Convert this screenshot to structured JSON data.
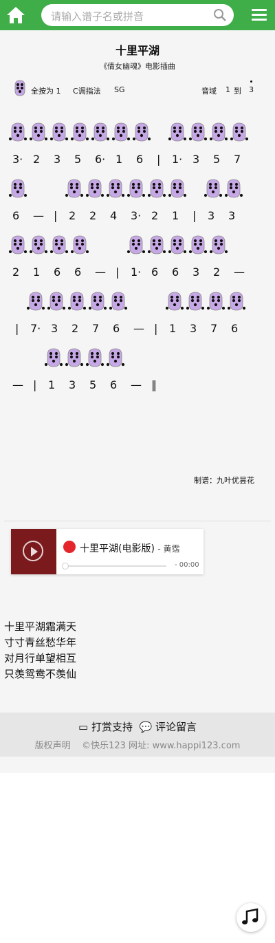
{
  "header": {
    "home_icon": "home-icon",
    "search_placeholder": "请输入谱子名或拼音",
    "search_icon": "search-icon",
    "menu_icon": "hamburger-menu-icon",
    "accent": "#3fae49"
  },
  "song": {
    "title": "十里平湖",
    "subtitle": "《倩女幽魂》电影插曲",
    "fingering_full": "全按为 1",
    "key": "C调指法",
    "model": "SG",
    "range_label": "音域",
    "range_low": "1",
    "range_to": "到",
    "range_high": "3"
  },
  "score": {
    "lines": [
      [
        "3·",
        "2",
        "3",
        "5",
        "6·",
        "1",
        "6",
        "|",
        "1·",
        "3",
        "5",
        "7"
      ],
      [
        "6",
        "—",
        "|",
        "2",
        "2",
        "4",
        "3·",
        "2",
        "1",
        "|",
        "3",
        "3"
      ],
      [
        "2",
        "1",
        "6",
        "6",
        "—",
        "|",
        "1·",
        "6",
        "6",
        "3",
        "2",
        "—"
      ],
      [
        "|",
        "7·",
        "3",
        "2",
        "7",
        "6",
        "—",
        "|",
        "1",
        "3",
        "7",
        "6"
      ],
      [
        "—",
        "|",
        "1",
        "3",
        "5",
        "6",
        "—",
        "‖"
      ]
    ]
  },
  "credit": "制谱：九叶优昙花",
  "player": {
    "song": "十里平湖(电影版)",
    "artist": "- 黄霑",
    "time": "- 00:00",
    "cover_color": "#7b1a1c"
  },
  "lyrics": [
    "十里平湖霜满天",
    "寸寸青丝愁华年",
    "对月行单望相互",
    "只羡鸳鸯不羡仙"
  ],
  "footer": {
    "reward": "打赏支持",
    "comment": "评论留言",
    "copyright": "版权声明",
    "site": "©快乐123 网址: www.happi123.com"
  }
}
